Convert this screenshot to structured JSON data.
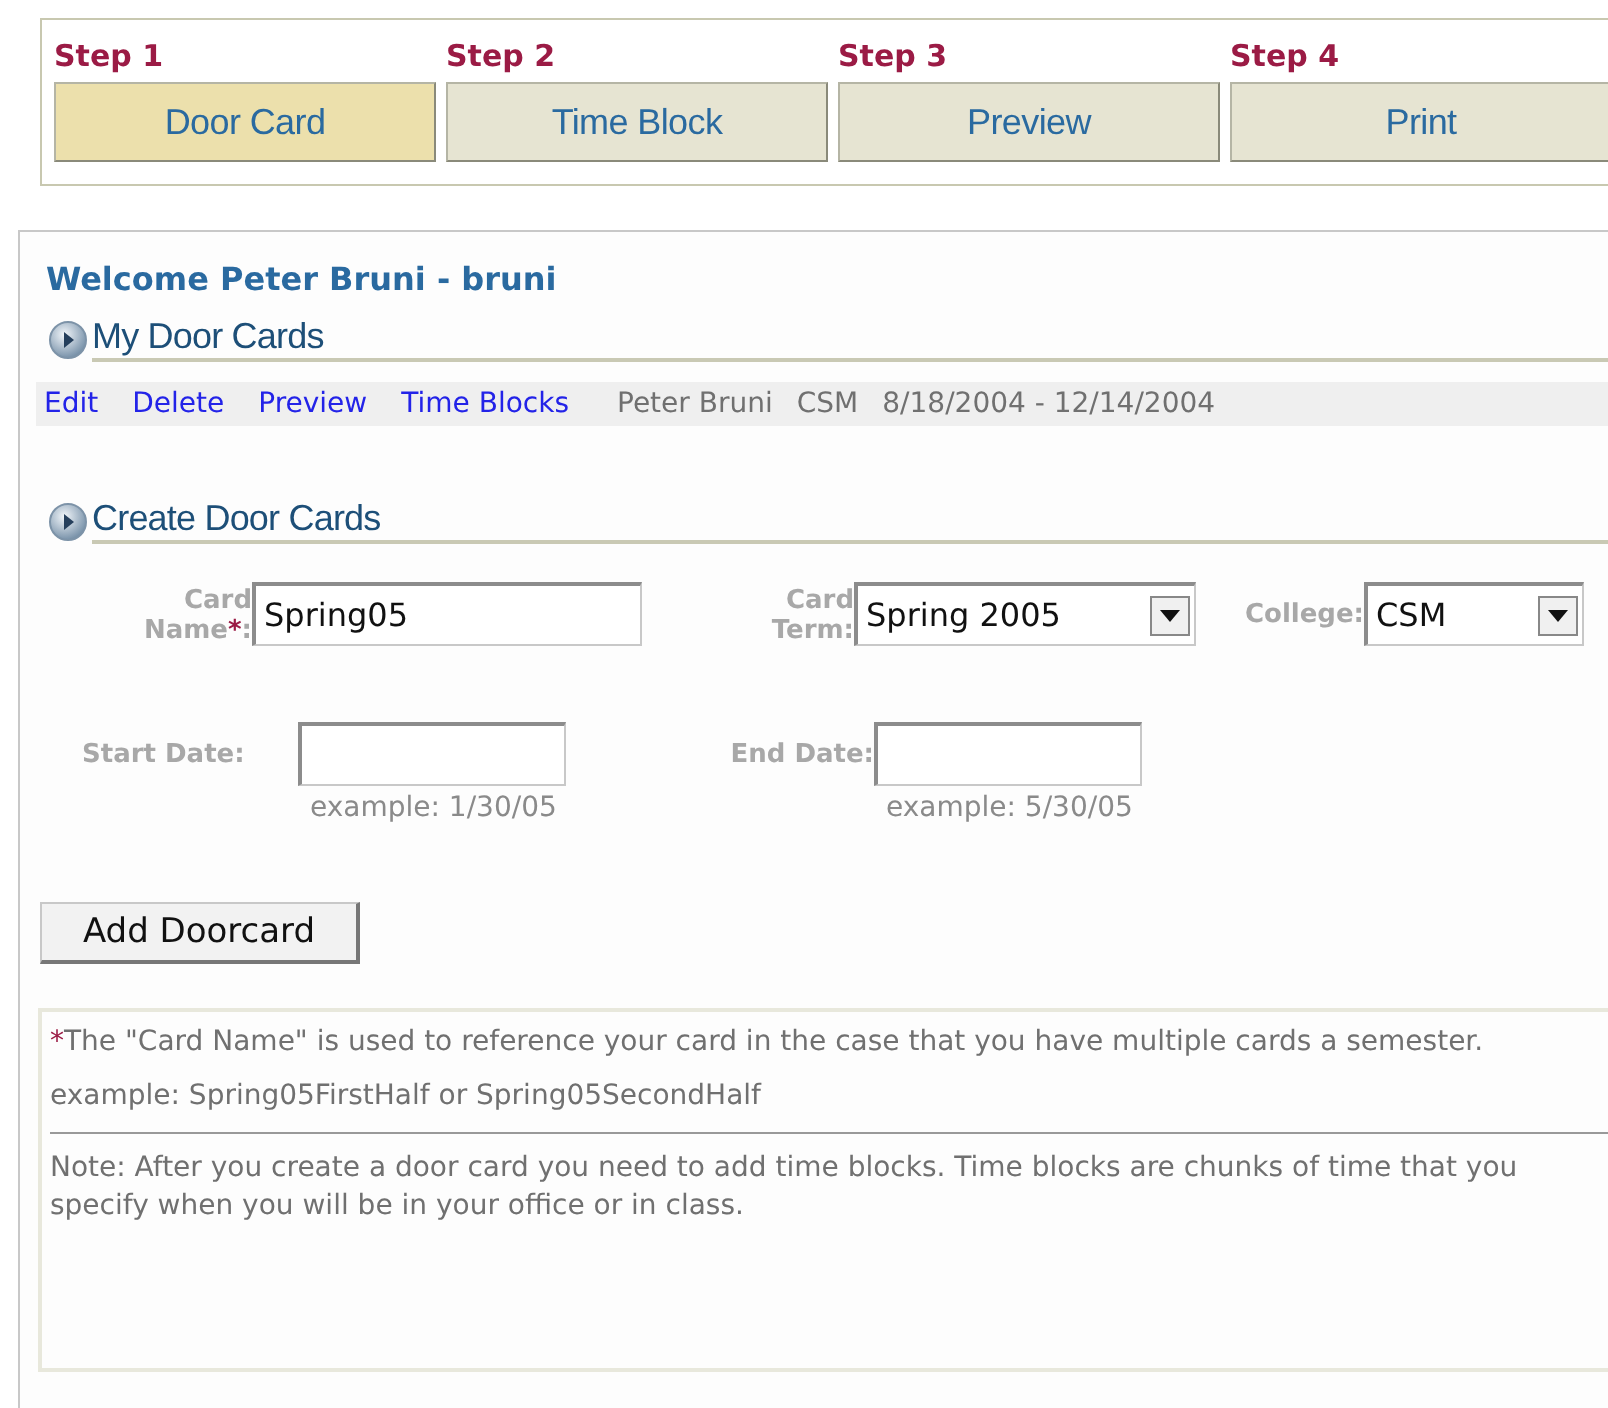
{
  "steps": [
    {
      "step": "Step 1",
      "label": "Door Card",
      "selected": true
    },
    {
      "step": "Step 2",
      "label": "Time Block",
      "selected": false
    },
    {
      "step": "Step 3",
      "label": "Preview",
      "selected": false
    },
    {
      "step": "Step 4",
      "label": "Print",
      "selected": false
    }
  ],
  "welcome": "Welcome Peter Bruni - bruni",
  "my_door_cards": {
    "heading": "My Door Cards",
    "rows": [
      {
        "actions": [
          "Edit",
          "Delete",
          "Preview",
          "Time Blocks"
        ],
        "name": "Peter Bruni",
        "college": "CSM",
        "dates": "8/18/2004 - 12/14/2004"
      }
    ]
  },
  "create_door_cards": {
    "heading": "Create Door Cards",
    "card_name": {
      "label": [
        "Card",
        "Name"
      ],
      "required_mark": "*",
      "colon": ":",
      "value": "Spring05"
    },
    "card_term": {
      "label": [
        "Card",
        "Term:"
      ],
      "value": "Spring 2005"
    },
    "college": {
      "label": "College:",
      "value": "CSM"
    },
    "start_date": {
      "label": "Start Date:",
      "example": "example: 1/30/05"
    },
    "end_date": {
      "label": "End Date:",
      "example": "example: 5/30/05"
    },
    "button": "Add Doorcard"
  },
  "notes": {
    "required_mark": "*",
    "text": "The \"Card Name\" is used to reference your card in the case that you have multiple cards a semester.",
    "example": "example: Spring05FirstHalf or Spring05SecondHalf",
    "note": "Note: After you create a door card you need to add time blocks. Time blocks are chunks of time that you specify when you will be in your office or in class."
  }
}
